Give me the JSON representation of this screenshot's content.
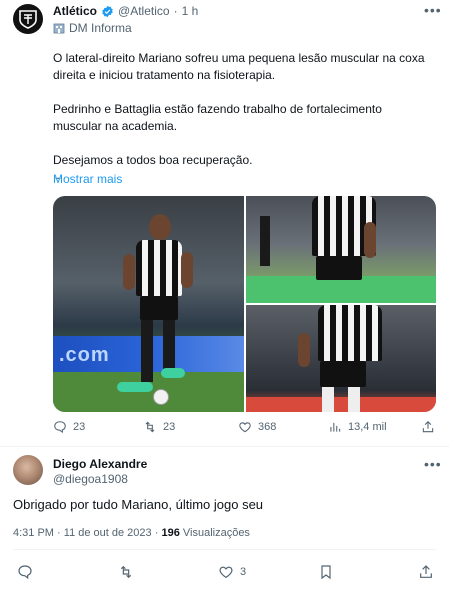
{
  "quoted_tweet": {
    "author_name": "Atlético",
    "author_handle": "@Atletico",
    "separator": "·",
    "time": "1 h",
    "label": "DM Informa",
    "paragraphs": [
      "O lateral-direito Mariano sofreu uma pequena lesão muscular na coxa direita e iniciou tratamento na fisioterapia.",
      "Pedrinho e Battaglia estão fazendo trabalho de fortalecimento muscular na academia.",
      "Desejamos a todos boa recuperação."
    ],
    "ellipsis": "...",
    "show_more": "Mostrar mais",
    "banner_text": ".com",
    "stats": {
      "replies": "23",
      "retweets": "23",
      "likes": "368",
      "views": "13,4 mil"
    }
  },
  "reply_tweet": {
    "author_name": "Diego Alexandre",
    "author_handle": "@diegoa1908",
    "text": "Obrigado por tudo Mariano, último jogo seu",
    "time": "4:31 PM",
    "separator": "·",
    "date": "11 de out de 2023",
    "views_count": "196",
    "views_label": "Visualizações",
    "stats": {
      "likes": "3"
    }
  },
  "colors": {
    "accent": "#1d9bf0",
    "muted": "#536471",
    "text": "#0f1419"
  },
  "icons": [
    "more-icon",
    "verified-icon",
    "building-icon",
    "reply-icon",
    "retweet-icon",
    "like-icon",
    "views-icon",
    "share-icon",
    "bookmark-icon"
  ]
}
